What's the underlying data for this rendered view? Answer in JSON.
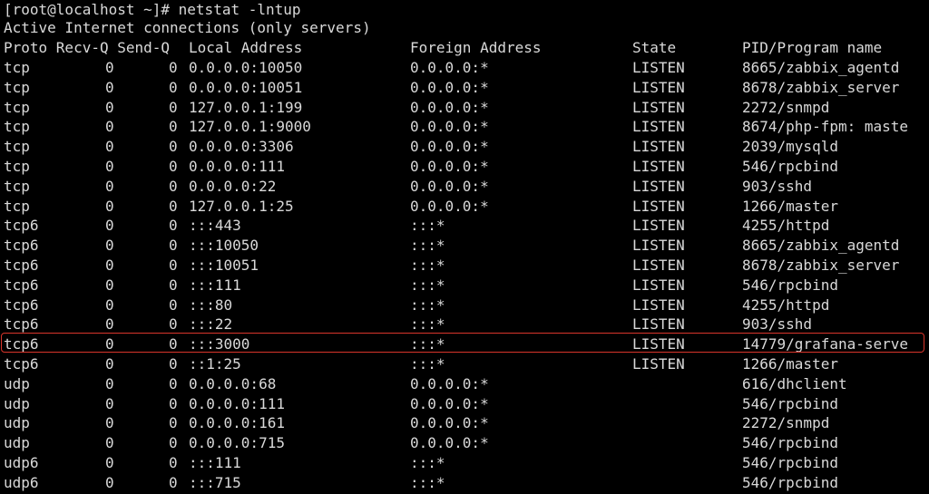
{
  "terminal": {
    "prompt": "[root@localhost ~]# netstat -lntup",
    "banner": "Active Internet connections (only servers)",
    "highlight_color": "#d9352b",
    "text_color": "#d9d9d9",
    "background_color": "#000000",
    "columns": [
      "Proto Recv-Q Send-Q",
      "Local Address",
      "Foreign Address",
      "State",
      "PID/Program name"
    ],
    "rows": [
      {
        "proto": "tcp",
        "recvq": "0",
        "sendq": "0",
        "local": "0.0.0.0:10050",
        "foreign": "0.0.0.0:*",
        "state": "LISTEN",
        "pid": "8665/zabbix_agentd"
      },
      {
        "proto": "tcp",
        "recvq": "0",
        "sendq": "0",
        "local": "0.0.0.0:10051",
        "foreign": "0.0.0.0:*",
        "state": "LISTEN",
        "pid": "8678/zabbix_server"
      },
      {
        "proto": "tcp",
        "recvq": "0",
        "sendq": "0",
        "local": "127.0.0.1:199",
        "foreign": "0.0.0.0:*",
        "state": "LISTEN",
        "pid": "2272/snmpd"
      },
      {
        "proto": "tcp",
        "recvq": "0",
        "sendq": "0",
        "local": "127.0.0.1:9000",
        "foreign": "0.0.0.0:*",
        "state": "LISTEN",
        "pid": "8674/php-fpm: maste"
      },
      {
        "proto": "tcp",
        "recvq": "0",
        "sendq": "0",
        "local": "0.0.0.0:3306",
        "foreign": "0.0.0.0:*",
        "state": "LISTEN",
        "pid": "2039/mysqld"
      },
      {
        "proto": "tcp",
        "recvq": "0",
        "sendq": "0",
        "local": "0.0.0.0:111",
        "foreign": "0.0.0.0:*",
        "state": "LISTEN",
        "pid": "546/rpcbind"
      },
      {
        "proto": "tcp",
        "recvq": "0",
        "sendq": "0",
        "local": "0.0.0.0:22",
        "foreign": "0.0.0.0:*",
        "state": "LISTEN",
        "pid": "903/sshd"
      },
      {
        "proto": "tcp",
        "recvq": "0",
        "sendq": "0",
        "local": "127.0.0.1:25",
        "foreign": "0.0.0.0:*",
        "state": "LISTEN",
        "pid": "1266/master"
      },
      {
        "proto": "tcp6",
        "recvq": "0",
        "sendq": "0",
        "local": ":::443",
        "foreign": ":::*",
        "state": "LISTEN",
        "pid": "4255/httpd"
      },
      {
        "proto": "tcp6",
        "recvq": "0",
        "sendq": "0",
        "local": ":::10050",
        "foreign": ":::*",
        "state": "LISTEN",
        "pid": "8665/zabbix_agentd"
      },
      {
        "proto": "tcp6",
        "recvq": "0",
        "sendq": "0",
        "local": ":::10051",
        "foreign": ":::*",
        "state": "LISTEN",
        "pid": "8678/zabbix_server"
      },
      {
        "proto": "tcp6",
        "recvq": "0",
        "sendq": "0",
        "local": ":::111",
        "foreign": ":::*",
        "state": "LISTEN",
        "pid": "546/rpcbind"
      },
      {
        "proto": "tcp6",
        "recvq": "0",
        "sendq": "0",
        "local": ":::80",
        "foreign": ":::*",
        "state": "LISTEN",
        "pid": "4255/httpd"
      },
      {
        "proto": "tcp6",
        "recvq": "0",
        "sendq": "0",
        "local": ":::22",
        "foreign": ":::*",
        "state": "LISTEN",
        "pid": "903/sshd"
      },
      {
        "proto": "tcp6",
        "recvq": "0",
        "sendq": "0",
        "local": ":::3000",
        "foreign": ":::*",
        "state": "LISTEN",
        "pid": "14779/grafana-serve"
      },
      {
        "proto": "tcp6",
        "recvq": "0",
        "sendq": "0",
        "local": "::1:25",
        "foreign": ":::*",
        "state": "LISTEN",
        "pid": "1266/master"
      },
      {
        "proto": "udp",
        "recvq": "0",
        "sendq": "0",
        "local": "0.0.0.0:68",
        "foreign": "0.0.0.0:*",
        "state": "",
        "pid": "616/dhclient"
      },
      {
        "proto": "udp",
        "recvq": "0",
        "sendq": "0",
        "local": "0.0.0.0:111",
        "foreign": "0.0.0.0:*",
        "state": "",
        "pid": "546/rpcbind"
      },
      {
        "proto": "udp",
        "recvq": "0",
        "sendq": "0",
        "local": "0.0.0.0:161",
        "foreign": "0.0.0.0:*",
        "state": "",
        "pid": "2272/snmpd"
      },
      {
        "proto": "udp",
        "recvq": "0",
        "sendq": "0",
        "local": "0.0.0.0:715",
        "foreign": "0.0.0.0:*",
        "state": "",
        "pid": "546/rpcbind"
      },
      {
        "proto": "udp6",
        "recvq": "0",
        "sendq": "0",
        "local": ":::111",
        "foreign": ":::*",
        "state": "",
        "pid": "546/rpcbind"
      },
      {
        "proto": "udp6",
        "recvq": "0",
        "sendq": "0",
        "local": ":::715",
        "foreign": ":::*",
        "state": "",
        "pid": "546/rpcbind"
      }
    ]
  }
}
